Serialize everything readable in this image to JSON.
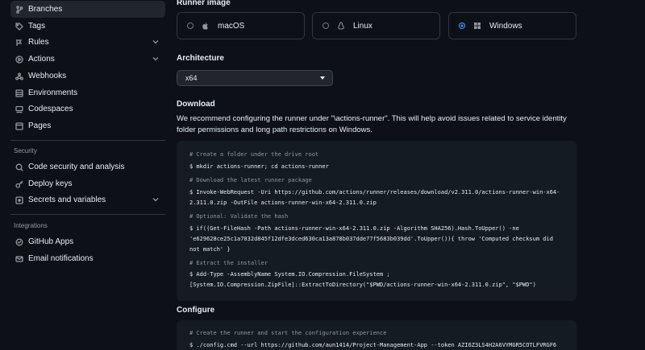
{
  "sidebar": {
    "items": [
      {
        "label": "Branches",
        "icon": "branch-icon",
        "active": true
      },
      {
        "label": "Tags",
        "icon": "tag-icon"
      },
      {
        "label": "Rules",
        "icon": "rules-icon",
        "expandable": true
      },
      {
        "label": "Actions",
        "icon": "actions-icon",
        "expandable": true
      },
      {
        "label": "Webhooks",
        "icon": "webhook-icon"
      },
      {
        "label": "Environments",
        "icon": "environments-icon"
      },
      {
        "label": "Codespaces",
        "icon": "codespaces-icon"
      },
      {
        "label": "Pages",
        "icon": "pages-icon"
      }
    ],
    "security_heading": "Security",
    "security_items": [
      {
        "label": "Code security and analysis",
        "icon": "codescan-icon"
      },
      {
        "label": "Deploy keys",
        "icon": "key-icon"
      },
      {
        "label": "Secrets and variables",
        "icon": "asterisk-icon",
        "expandable": true
      }
    ],
    "integrations_heading": "Integrations",
    "integrations_items": [
      {
        "label": "GitHub Apps",
        "icon": "apps-icon"
      },
      {
        "label": "Email notifications",
        "icon": "mail-icon"
      }
    ]
  },
  "runner": {
    "heading": "Runner image",
    "options": [
      {
        "label": "macOS",
        "icon": "apple-icon",
        "selected": false
      },
      {
        "label": "Linux",
        "icon": "linux-icon",
        "selected": false
      },
      {
        "label": "Windows",
        "icon": "windows-icon",
        "selected": true
      }
    ]
  },
  "architecture": {
    "heading": "Architecture",
    "value": "x64"
  },
  "download": {
    "heading": "Download",
    "paragraph": "We recommend configuring the runner under \"\\actions-runner\". This will help avoid issues related to service identity folder permissions and long path restrictions on Windows.",
    "code_lines": [
      {
        "text": "# Create a folder under the drive root",
        "comment": true
      },
      {
        "text": "$ mkdir actions-runner; cd actions-runner",
        "comment": false
      },
      {
        "text": "# Download the latest runner package",
        "comment": true
      },
      {
        "text": "$ Invoke-WebRequest -Uri https://github.com/actions/runner/releases/download/v2.311.0/actions-runner-win-x64-",
        "comment": false
      },
      {
        "text": "2.311.0.zip -OutFile actions-runner-win-x64-2.311.0.zip",
        "comment": false
      },
      {
        "text": "# Optional: Validate the hash",
        "comment": true
      },
      {
        "text": "$ if((Get-FileHash -Path actions-runner-win-x64-2.311.0.zip -Algorithm SHA256).Hash.ToUpper() -ne",
        "comment": false
      },
      {
        "text": "'e629628ce25c1a7032d845f12dfe3dced630ca13a878b037dde77f5683b039dd'.ToUpper()){ throw 'Computed checksum did",
        "comment": false
      },
      {
        "text": "not match' }",
        "comment": false
      },
      {
        "text": "# Extract the installer",
        "comment": true
      },
      {
        "text": "$ Add-Type -AssemblyName System.IO.Compression.FileSystem ;",
        "comment": false
      },
      {
        "text": "[System.IO.Compression.ZipFile]::ExtractToDirectory(\"$PWD/actions-runner-win-x64-2.311.0.zip\", \"$PWD\")",
        "comment": false
      }
    ]
  },
  "configure": {
    "heading": "Configure",
    "code_lines": [
      {
        "text": "# Create the runner and start the configuration experience",
        "comment": true
      },
      {
        "text": "$ ./config.cmd --url https://github.com/aun1414/Project-Management-App --token AZI6Z3LS4H2A6VYMGR5COTLFVRGF6",
        "comment": false
      }
    ]
  },
  "colors": {
    "background": "#0d1117",
    "card_border": "#30363d",
    "code_background": "#151b23",
    "accent": "#4493f8",
    "muted": "#9198a1"
  }
}
